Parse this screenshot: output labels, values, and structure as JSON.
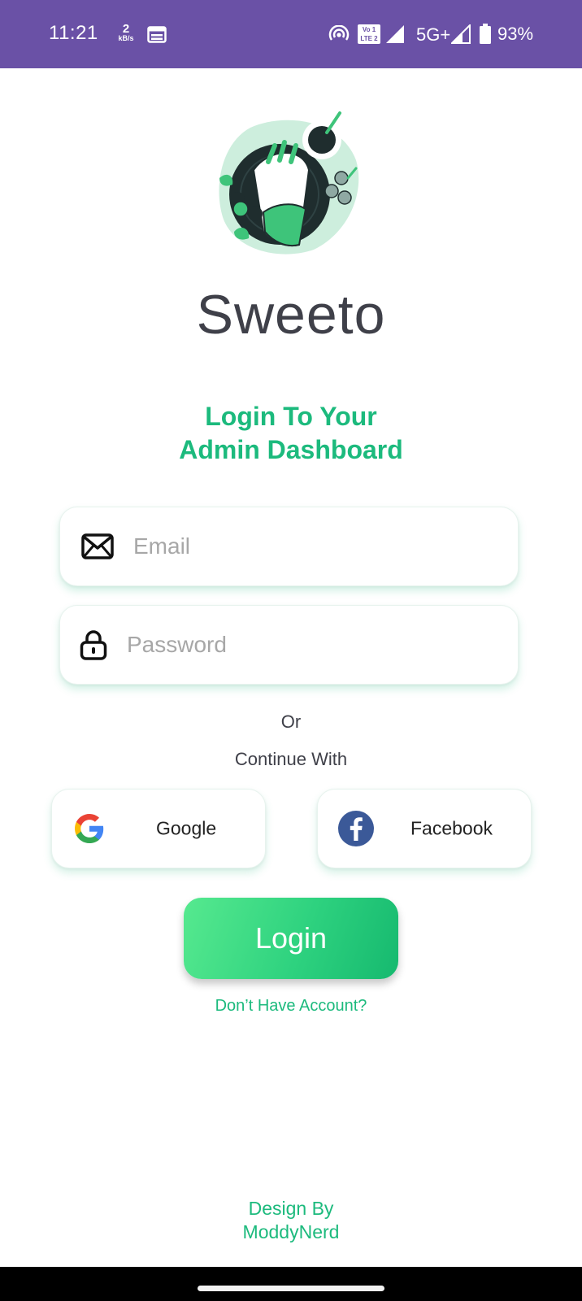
{
  "status_bar": {
    "time": "11:21",
    "net_speed_value": "2",
    "net_speed_unit": "kB/s",
    "volte_badge_top": "Vo 1",
    "volte_badge_bottom": "LTE 2",
    "network_type": "5G+",
    "battery": "93%",
    "background_color": "#6a51a6",
    "icons": [
      "calendar-icon",
      "hotspot-icon",
      "volte-icon",
      "signal-icon",
      "signal-icon",
      "battery-icon"
    ]
  },
  "app": {
    "name": "Sweeto",
    "headline_line1": "Login To Your",
    "headline_line2": "Admin Dashboard",
    "illustration": "food-bowl-illustration"
  },
  "form": {
    "email_placeholder": "Email",
    "email_icon": "mail-icon",
    "password_placeholder": "Password",
    "password_icon": "lock-icon"
  },
  "social": {
    "or": "Or",
    "continue_with": "Continue With",
    "google_label": "Google",
    "facebook_label": "Facebook"
  },
  "actions": {
    "login_label": "Login",
    "signup_link": "Don’t Have Account?"
  },
  "footer": {
    "line1": "Design By",
    "line2": "ModdyNerd"
  },
  "colors": {
    "accent": "#1cba7d",
    "title": "#3f4049",
    "login_gradient_start": "#56e98f",
    "login_gradient_end": "#16b96f"
  }
}
